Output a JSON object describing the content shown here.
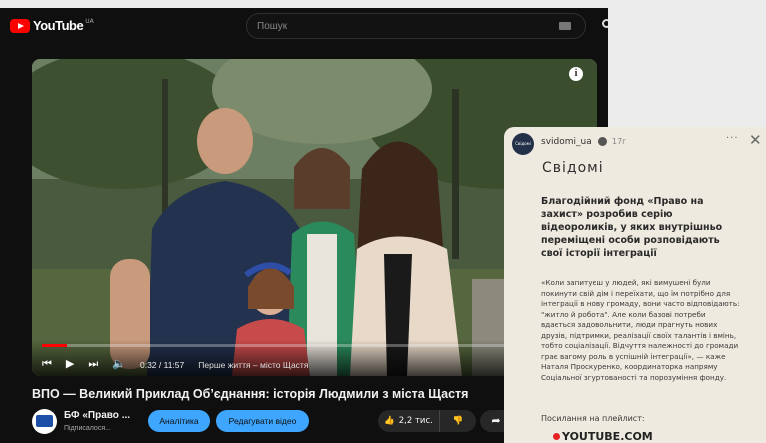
{
  "youtube": {
    "logo_text": "YouTube",
    "region": "UA",
    "search_placeholder": "Пошук",
    "video": {
      "current_time": "0:32 / 11:57",
      "chapter": "Перше життя – місто Щастя",
      "progress": 0.045
    },
    "title": "ВПО — Великий Приклад Об’єднання: історія Людмили з міста Щастя",
    "channel": {
      "name": "БФ «Право ...",
      "subscribers": "Підписалося..."
    },
    "buttons": {
      "analytics": "Аналітика",
      "edit_video": "Редагувати відео"
    },
    "likes": "2,2 тис."
  },
  "story": {
    "username": "svidomi_ua",
    "age": "17г",
    "brand": "Свідомі",
    "avatar_text": "Свідомі",
    "headline": "Благодійний фонд «Право на захист» розробив серію відеороликів, у яких внутрішньо переміщені особи розповідають свої історії інтеграції",
    "body": "«Коли запитуєш у людей, які вимушені були покинути свій дім і переїхати, що їм потрібно для інтеграції в нову громаду, вони часто відповідають: \"житло й робота\". Але коли базові потреби вдається задовольнити, люди прагнуть нових друзів, підтримки, реалізації своїх талантів і вмінь, тобто соціалізації. Відчуття належності до громади грає вагому роль в успішній інтеграції», — каже Наталя Проскуренко, координаторка напряму Соціальної згуртованості та порозуміння фонду.",
    "playlist_label": "Посилання на плейлист:",
    "playlist_badge": "YOUTUBE.COM"
  }
}
